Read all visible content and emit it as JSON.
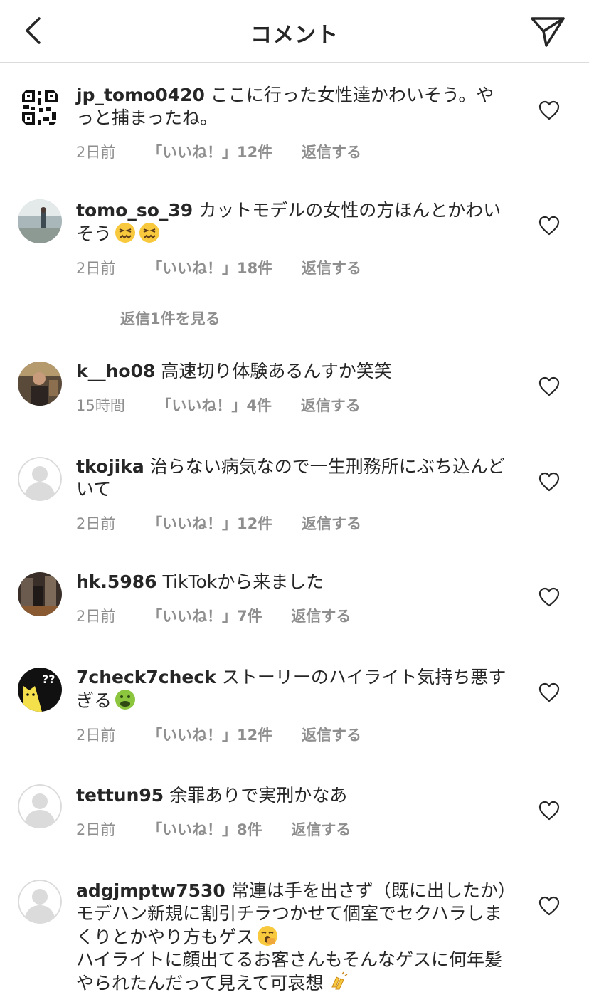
{
  "header": {
    "title": "コメント"
  },
  "comments": [
    {
      "username": "jp_tomo0420",
      "text": "ここに行った女性達かわいそう。やっと捕まったね。",
      "time": "2日前",
      "likes": "「いいね！」12件",
      "reply": "返信する",
      "avatar": "qr-code-avatar"
    },
    {
      "username": "tomo_so_39",
      "text": "カットモデルの女性の方ほんとかわいそう",
      "emojis": [
        "confounded-face-emoji",
        "confounded-face-emoji"
      ],
      "time": "2日前",
      "likes": "「いいね！」18件",
      "reply": "返信する",
      "avatar": "beach-photo-avatar"
    },
    {
      "username": "k__ho08",
      "text": "高速切り体験あるんすか笑笑",
      "time": "15時間",
      "likes": "「いいね！」4件",
      "reply": "返信する",
      "avatar": "person-photo-avatar"
    },
    {
      "username": "tkojika",
      "text": "治らない病気なので一生刑務所にぶち込んどいて",
      "time": "2日前",
      "likes": "「いいね！」12件",
      "reply": "返信する",
      "avatar": "default-avatar"
    },
    {
      "username": "hk.5986",
      "text": "TikTokから来ました",
      "time": "2日前",
      "likes": "「いいね！」7件",
      "reply": "返信する",
      "avatar": "room-photo-avatar"
    },
    {
      "username": "7check7check",
      "text": "ストーリーのハイライト気持ち悪すぎる",
      "emojis": [
        "nauseated-face-emoji"
      ],
      "time": "2日前",
      "likes": "「いいね！」12件",
      "reply": "返信する",
      "avatar": "cat-illustration-avatar"
    },
    {
      "username": "tettun95",
      "text": "余罪ありで実刑かなあ",
      "time": "2日前",
      "likes": "「いいね！」8件",
      "reply": "返信する",
      "avatar": "default-avatar"
    },
    {
      "username": "adgjmptw7530",
      "text": "常連は手を出さず（既に出したか）モデハン新規に割引チラつかせて個室でセクハラしまくりとかやり方もゲス",
      "emojis": [
        "yawning-face-emoji"
      ],
      "text2": "ハイライトに顔出てるお客さんもそんなゲスに何年髪やられたんだって見えて可哀想",
      "emojis2": [
        "clapping-hands-emoji"
      ],
      "avatar": "default-avatar"
    }
  ],
  "view_replies": "返信1件を見る",
  "colors": {
    "text": "#262626",
    "secondary": "#8e8e8e",
    "divider": "#dbdbdb"
  }
}
